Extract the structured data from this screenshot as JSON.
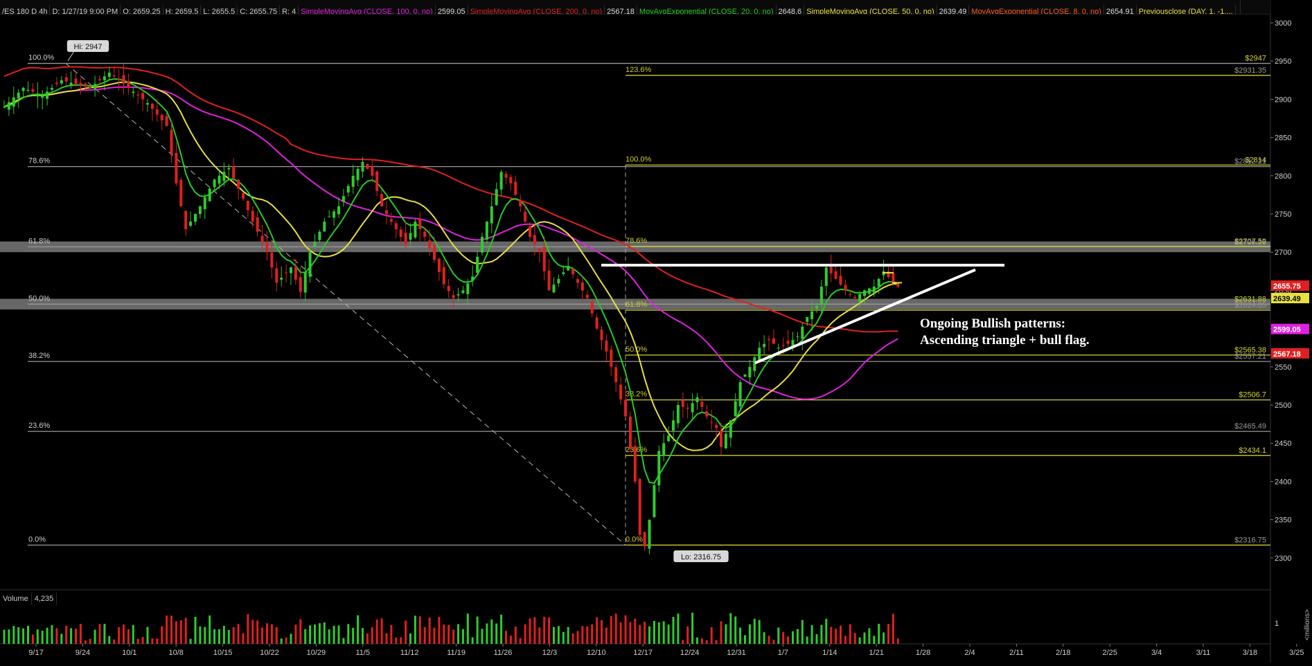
{
  "header": {
    "symbol": "/ES 180 D 4h",
    "date": "D: 1/27/19 9:00 PM",
    "open": "O: 2659.25",
    "high": "H: 2659.5",
    "low": "L: 2655.5",
    "close": "C: 2655.75",
    "range": "R: 4",
    "indicators": [
      {
        "label": "SimpleMovingAvg (CLOSE, 100, 0, no)",
        "value": "2599.05",
        "color": "#e020e0"
      },
      {
        "label": "SimpleMovingAvg (CLOSE, 200, 0, no)",
        "value": "2567.18",
        "color": "#e02020"
      },
      {
        "label": "MovAvgExponential (CLOSE, 20, 0, no)",
        "value": "2648.6",
        "color": "#22cc22"
      },
      {
        "label": "SimpleMovingAvg (CLOSE, 50, 0, no)",
        "value": "2639.49",
        "color": "#e8e040"
      },
      {
        "label": "MovAvgExponential (CLOSE, 8, 0, no)",
        "value": "2654.91",
        "color": "#ff5a1a"
      },
      {
        "label": "Previousclose (DAY, 1, -1,...",
        "value": "",
        "color": "#e8e040"
      }
    ]
  },
  "volume": {
    "label": "Volume",
    "value": "4,235",
    "axis_tick": "1",
    "axis_unit": "<millions>"
  },
  "annotation": {
    "line1": "Ongoing Bullish patterns:",
    "line2": "Ascending triangle + bull flag."
  },
  "markers": {
    "high": "Hi: 2947",
    "low": "Lo: 2316.75"
  },
  "colors": {
    "up": "#2ecc2e",
    "down": "#e02020",
    "sma100": "#e020e0",
    "sma200": "#e02020",
    "ema20": "#22cc22",
    "sma50": "#e8e040",
    "fib_left": "#9a9a9a",
    "fib_right": "#cfcf2a"
  },
  "chart_data": {
    "type": "candlestick",
    "y_axis": {
      "range": [
        2260,
        3010
      ],
      "ticks": [
        2300,
        2350,
        2400,
        2450,
        2500,
        2550,
        2600,
        2650,
        2700,
        2750,
        2800,
        2850,
        2900,
        2950,
        3000
      ]
    },
    "x_axis": {
      "ticks": [
        "9/17",
        "9/24",
        "10/1",
        "10/8",
        "10/15",
        "10/22",
        "10/29",
        "11/5",
        "11/12",
        "11/19",
        "11/26",
        "12/3",
        "12/10",
        "12/17",
        "12/24",
        "12/31",
        "1/7",
        "1/14",
        "1/21",
        "1/28",
        "2/4",
        "2/11",
        "2/18",
        "2/25",
        "3/4",
        "3/11",
        "3/18",
        "3/25"
      ]
    },
    "fib_left": [
      {
        "label": "100.0%",
        "price": 2947
      },
      {
        "label": "78.6%",
        "price": 2812
      },
      {
        "label": "61.8%",
        "price": 2707
      },
      {
        "label": "50.0%",
        "price": 2632
      },
      {
        "label": "38.2%",
        "price": 2557
      },
      {
        "label": "23.6%",
        "price": 2465.49
      },
      {
        "label": "0.0%",
        "price": 2316.75
      }
    ],
    "fib_right": [
      {
        "label": "123.6%",
        "price": 2931.35
      },
      {
        "label": "100.0%",
        "price": 2814
      },
      {
        "label": "78.6%",
        "price": 2707.59
      },
      {
        "label": "61.8%",
        "price": 2624.05
      },
      {
        "label": "50.0%",
        "price": 2565.38
      },
      {
        "label": "38.2%",
        "price": 2506.7
      },
      {
        "label": "23.6%",
        "price": 2434.1
      },
      {
        "label": "0.0%",
        "price": 2316.75
      }
    ],
    "price_labels_right": [
      "$2947",
      "$2931.35",
      "$2814",
      "$2812.21",
      "$2707.59",
      "$2706.29",
      "$2631.88",
      "$2624.05",
      "$2565.38",
      "$2557.21",
      "$2506.7",
      "$2465.49",
      "$2434.1",
      "$2316.75"
    ],
    "price_tags": [
      {
        "value": "2655.75",
        "bg": "#e02020",
        "fg": "#ffffff"
      },
      {
        "value": "2639.49",
        "bg": "#e8e040",
        "fg": "#000000"
      },
      {
        "value": "2599.05",
        "bg": "#e020e0",
        "fg": "#ffffff"
      },
      {
        "value": "2567.18",
        "bg": "#e02020",
        "fg": "#ffffff"
      }
    ],
    "zones": [
      {
        "from": 2700,
        "to": 2714
      },
      {
        "from": 2625,
        "to": 2639
      }
    ],
    "resistance": 2683,
    "volume_max_millions": 1.6,
    "candle_anchors": [
      [
        0,
        2890
      ],
      [
        4,
        2915
      ],
      [
        8,
        2905
      ],
      [
        12,
        2925
      ],
      [
        18,
        2915
      ],
      [
        22,
        2935
      ],
      [
        26,
        2915
      ],
      [
        30,
        2895
      ],
      [
        34,
        2865
      ],
      [
        36,
        2790
      ],
      [
        38,
        2730
      ],
      [
        41,
        2760
      ],
      [
        44,
        2795
      ],
      [
        47,
        2810
      ],
      [
        50,
        2770
      ],
      [
        52,
        2740
      ],
      [
        55,
        2700
      ],
      [
        57,
        2660
      ],
      [
        60,
        2680
      ],
      [
        62,
        2648
      ],
      [
        64,
        2700
      ],
      [
        67,
        2740
      ],
      [
        70,
        2760
      ],
      [
        73,
        2800
      ],
      [
        75,
        2818
      ],
      [
        77,
        2800
      ],
      [
        79,
        2760
      ],
      [
        81,
        2740
      ],
      [
        84,
        2710
      ],
      [
        86,
        2740
      ],
      [
        88,
        2720
      ],
      [
        90,
        2690
      ],
      [
        92,
        2658
      ],
      [
        94,
        2640
      ],
      [
        96,
        2650
      ],
      [
        98,
        2668
      ],
      [
        100,
        2720
      ],
      [
        102,
        2760
      ],
      [
        104,
        2805
      ],
      [
        106,
        2790
      ],
      [
        108,
        2760
      ],
      [
        110,
        2720
      ],
      [
        112,
        2700
      ],
      [
        114,
        2650
      ],
      [
        116,
        2665
      ],
      [
        118,
        2682
      ],
      [
        120,
        2660
      ],
      [
        122,
        2640
      ],
      [
        124,
        2600
      ],
      [
        126,
        2570
      ],
      [
        128,
        2530
      ],
      [
        130,
        2485
      ],
      [
        132,
        2400
      ],
      [
        133,
        2330
      ],
      [
        134,
        2315
      ],
      [
        135,
        2350
      ],
      [
        137,
        2440
      ],
      [
        139,
        2460
      ],
      [
        141,
        2500
      ],
      [
        143,
        2495
      ],
      [
        145,
        2510
      ],
      [
        147,
        2485
      ],
      [
        149,
        2470
      ],
      [
        150,
        2445
      ],
      [
        152,
        2480
      ],
      [
        154,
        2530
      ],
      [
        156,
        2550
      ],
      [
        158,
        2575
      ],
      [
        160,
        2585
      ],
      [
        162,
        2575
      ],
      [
        164,
        2580
      ],
      [
        166,
        2590
      ],
      [
        168,
        2615
      ],
      [
        170,
        2630
      ],
      [
        172,
        2680
      ],
      [
        174,
        2665
      ],
      [
        176,
        2650
      ],
      [
        178,
        2640
      ],
      [
        180,
        2650
      ],
      [
        182,
        2655
      ],
      [
        184,
        2675
      ],
      [
        186,
        2660
      ],
      [
        187,
        2655
      ]
    ]
  }
}
